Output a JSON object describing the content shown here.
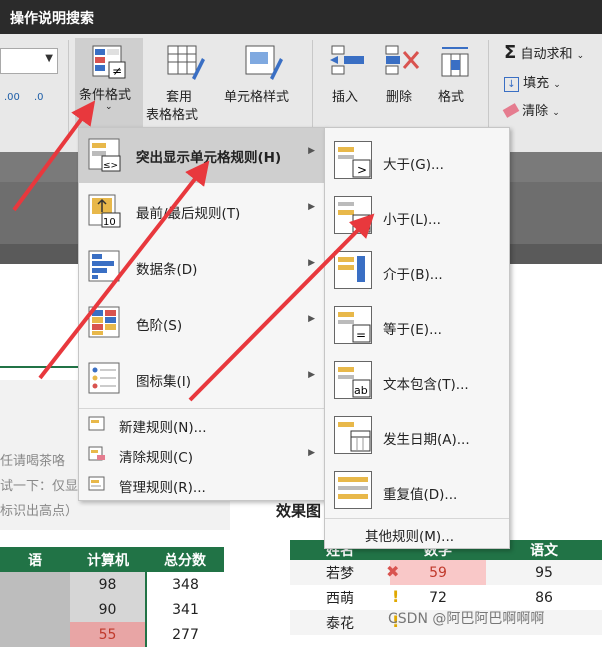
{
  "app": {
    "title": "操作说明搜索"
  },
  "ribbon": {
    "buttons": {
      "conditional_format": "条件格式",
      "table_format_line1": "套用",
      "table_format_line2": "表格格式",
      "cell_styles": "单元格样式",
      "insert": "插入",
      "delete": "删除",
      "format": "格式",
      "autosum": "自动求和",
      "fill": "填充",
      "clear": "清除"
    },
    "decimal_up": ".00",
    "decimal_down": ".0"
  },
  "menu_conditional": {
    "items": [
      {
        "label": "突出显示单元格规则(H)",
        "icon": "highlight-rules-icon"
      },
      {
        "label": "最前/最后规则(T)",
        "icon": "top-bottom-icon"
      },
      {
        "label": "数据条(D)",
        "icon": "data-bars-icon"
      },
      {
        "label": "色阶(S)",
        "icon": "color-scale-icon"
      },
      {
        "label": "图标集(I)",
        "icon": "icon-sets-icon"
      }
    ],
    "small_items": [
      {
        "label": "新建规则(N)...",
        "icon": "new-rule-icon"
      },
      {
        "label": "清除规则(C)",
        "icon": "clear-rules-icon"
      },
      {
        "label": "管理规则(R)...",
        "icon": "manage-rules-icon"
      }
    ]
  },
  "menu_highlight": {
    "items": [
      {
        "label": "大于(G)...",
        "icon": "greater-than-icon"
      },
      {
        "label": "小于(L)...",
        "icon": "less-than-icon"
      },
      {
        "label": "介于(B)...",
        "icon": "between-icon"
      },
      {
        "label": "等于(E)...",
        "icon": "equal-icon"
      },
      {
        "label": "文本包含(T)...",
        "icon": "text-contains-icon"
      },
      {
        "label": "发生日期(A)...",
        "icon": "date-occurring-icon"
      },
      {
        "label": "重复值(D)...",
        "icon": "duplicate-values-icon"
      }
    ],
    "more": "其他规则(M)..."
  },
  "sheet": {
    "left_texts": [
      "任请喝茶咯",
      "试一下：仅显示",
      "标识出高点）"
    ],
    "effect_label": "效果图",
    "left_table": {
      "headers": [
        "语",
        "计算机",
        "总分数"
      ],
      "rows": [
        [
          "",
          "98",
          "348"
        ],
        [
          "",
          "90",
          "341"
        ],
        [
          "",
          "55",
          "277"
        ]
      ]
    },
    "right_table": {
      "headers": [
        "姓名",
        "数学",
        "语文"
      ],
      "rows": [
        [
          "若梦",
          "59",
          "95"
        ],
        [
          "西萌",
          "72",
          "86"
        ],
        [
          "泰花",
          "",
          ""
        ]
      ]
    }
  },
  "colors": {
    "accent_red": "#e8383d",
    "excel_green": "#217346",
    "highlight_pink": "#f9c8c8"
  },
  "watermark": "CSDN @阿巴阿巴啊啊啊"
}
